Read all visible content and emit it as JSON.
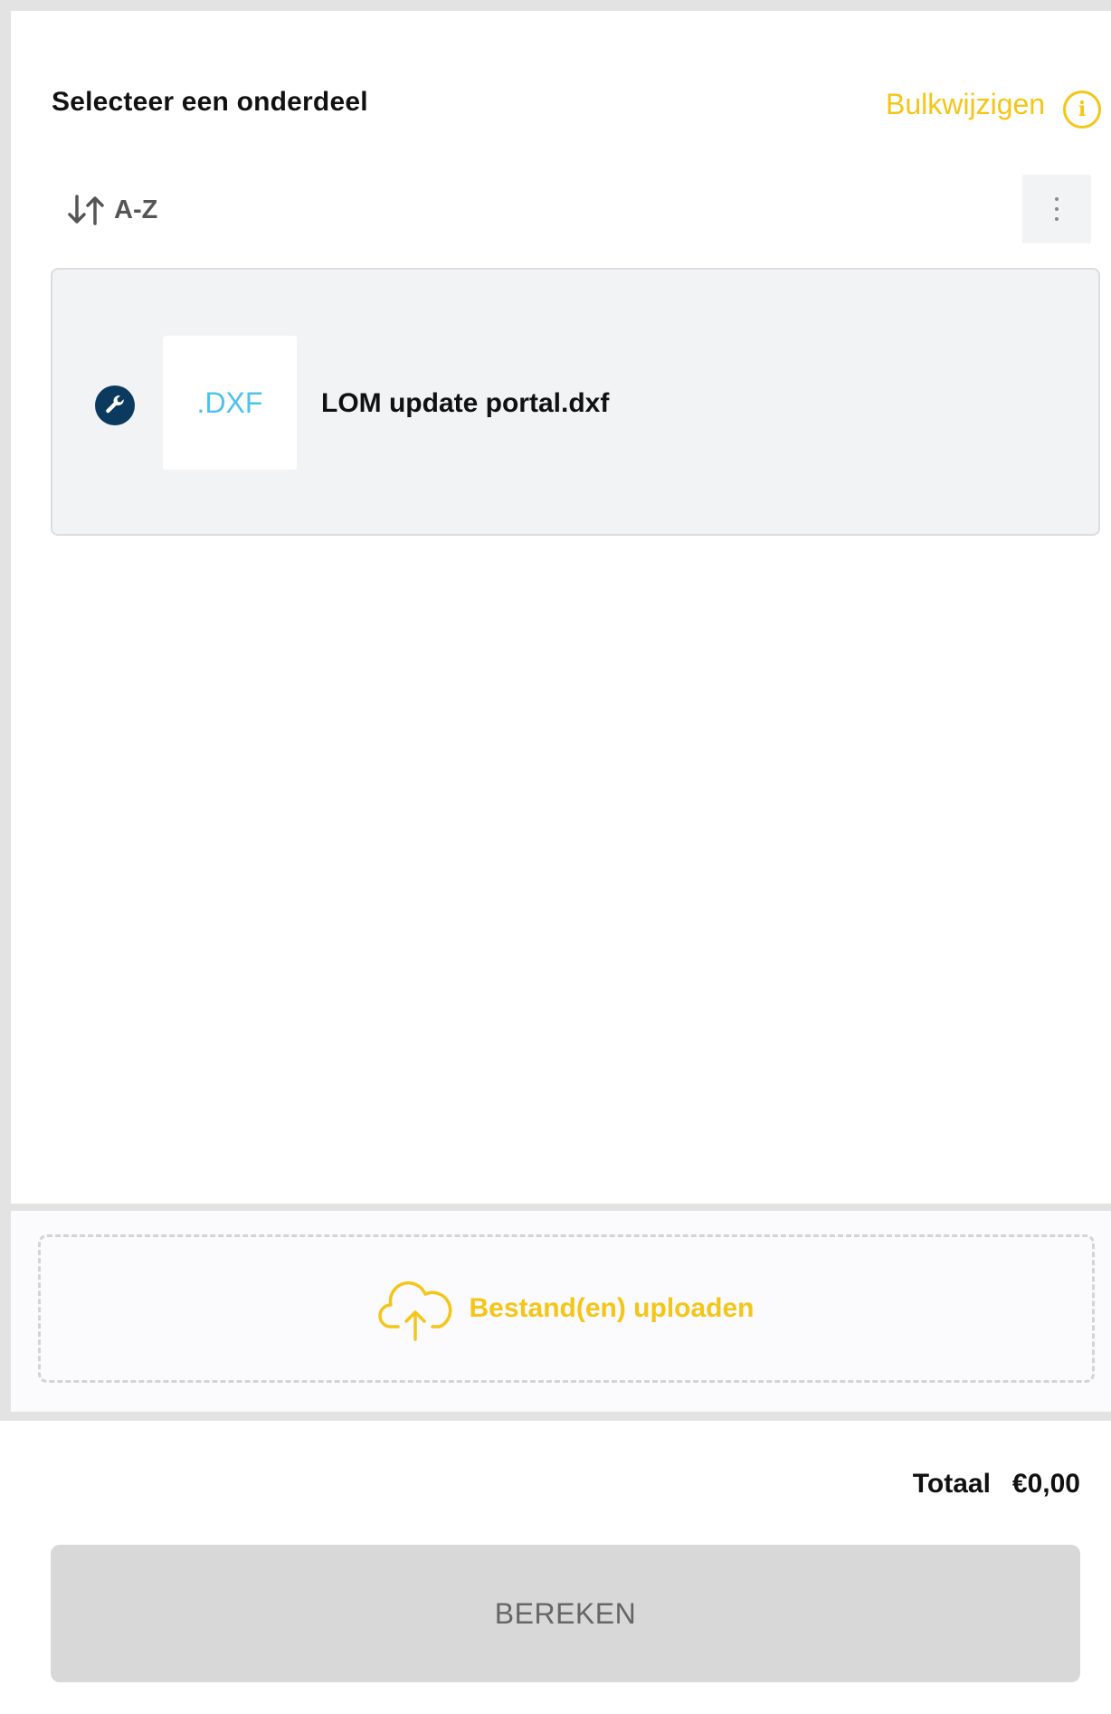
{
  "header": {
    "title": "Selecteer een onderdeel",
    "bulk_edit_label": "Bulkwijzigen",
    "info_icon": "info-icon"
  },
  "toolbar": {
    "sort_label": "A-Z",
    "sort_icon": "sort-icon",
    "more_icon": "more-vertical-icon"
  },
  "parts": [
    {
      "status_icon": "wrench-icon",
      "thumbnail_label": ".DXF",
      "file_name": "LOM update portal.dxf"
    }
  ],
  "upload": {
    "label": "Bestand(en) uploaden",
    "icon": "cloud-upload-icon"
  },
  "footer": {
    "total_label": "Totaal",
    "total_value": "€0,00",
    "calculate_label": "BEREKEN"
  },
  "colors": {
    "accent": "#f5c518",
    "status_icon_bg": "#0b3a5e",
    "dxf_text": "#4fc1ef",
    "card_bg": "#f2f3f5",
    "button_disabled_bg": "#d8d8d8"
  }
}
